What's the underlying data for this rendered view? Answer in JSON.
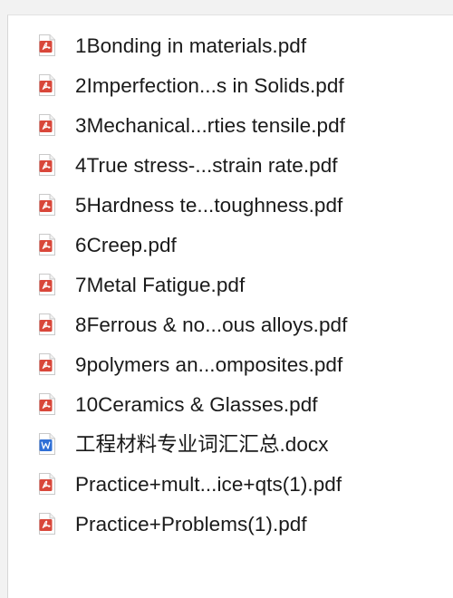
{
  "files": [
    {
      "name": "1Bonding in materials.pdf",
      "icon": "pdf-icon"
    },
    {
      "name": "2Imperfection...s in Solids.pdf",
      "icon": "pdf-icon"
    },
    {
      "name": "3Mechanical...rties tensile.pdf",
      "icon": "pdf-icon"
    },
    {
      "name": "4True stress-...strain rate.pdf",
      "icon": "pdf-icon"
    },
    {
      "name": "5Hardness te...toughness.pdf",
      "icon": "pdf-icon"
    },
    {
      "name": "6Creep.pdf",
      "icon": "pdf-icon"
    },
    {
      "name": "7Metal Fatigue.pdf",
      "icon": "pdf-icon"
    },
    {
      "name": "8Ferrous & no...ous alloys.pdf",
      "icon": "pdf-icon"
    },
    {
      "name": "9polymers an...omposites.pdf",
      "icon": "pdf-icon"
    },
    {
      "name": "10Ceramics & Glasses.pdf",
      "icon": "pdf-icon"
    },
    {
      "name": "工程材料专业词汇汇总.docx",
      "icon": "word-icon"
    },
    {
      "name": "Practice+mult...ice+qts(1).pdf",
      "icon": "pdf-icon"
    },
    {
      "name": "Practice+Problems(1).pdf",
      "icon": "pdf-icon"
    }
  ],
  "colors": {
    "pdf_red": "#d9473a",
    "word_blue": "#2f6fd6",
    "text": "#1a1a1a"
  }
}
